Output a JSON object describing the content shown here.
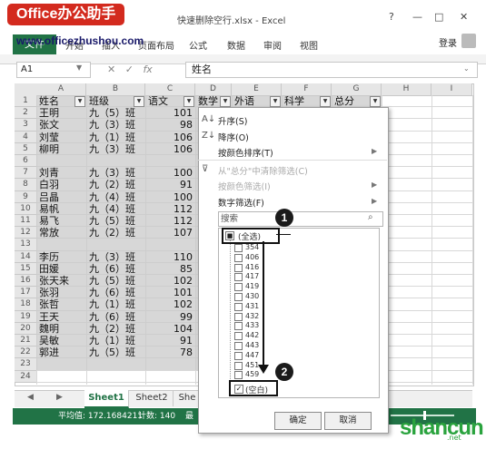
{
  "watermark_top": "Office办公助手",
  "site_url": "www.officezhushou.com",
  "window": {
    "title": "快速删除空行.xlsx - Excel",
    "help": "?",
    "minimize": "—",
    "restore": "□",
    "close": "✕"
  },
  "ribbon_tabs": [
    "文件",
    "开始",
    "插入",
    "页面布局",
    "公式",
    "数据",
    "审阅",
    "视图"
  ],
  "login": "登录",
  "namebox": "A1",
  "fx": "fx",
  "formula_value": "姓名",
  "col_headers": [
    "A",
    "B",
    "C",
    "D",
    "E",
    "F",
    "G",
    "H",
    "I"
  ],
  "table_headers": [
    "姓名",
    "班级",
    "语文",
    "数学",
    "外语",
    "科学",
    "总分"
  ],
  "rows": [
    [
      "2",
      "王明",
      "九（5）班",
      "101"
    ],
    [
      "3",
      "张文",
      "九（3）班",
      "98"
    ],
    [
      "4",
      "刘莹",
      "九（1）班",
      "106"
    ],
    [
      "5",
      "柳明",
      "九（3）班",
      "106"
    ],
    [
      "6",
      "",
      "",
      ""
    ],
    [
      "7",
      "刘青",
      "九（3）班",
      "100"
    ],
    [
      "8",
      "白羽",
      "九（2）班",
      "91"
    ],
    [
      "9",
      "吕晶",
      "九（4）班",
      "100"
    ],
    [
      "10",
      "易帆",
      "九（4）班",
      "112"
    ],
    [
      "11",
      "易飞",
      "九（5）班",
      "112"
    ],
    [
      "12",
      "常放",
      "九（2）班",
      "107"
    ],
    [
      "13",
      "",
      "",
      ""
    ],
    [
      "14",
      "李历",
      "九（3）班",
      "110"
    ],
    [
      "15",
      "田媛",
      "九（6）班",
      "85"
    ],
    [
      "16",
      "张天来",
      "九（5）班",
      "102"
    ],
    [
      "17",
      "张羽",
      "九（6）班",
      "101"
    ],
    [
      "18",
      "张哲",
      "九（1）班",
      "102"
    ],
    [
      "19",
      "王天",
      "九（6）班",
      "99"
    ],
    [
      "20",
      "魏明",
      "九（2）班",
      "104"
    ],
    [
      "21",
      "吴敏",
      "九（1）班",
      "91"
    ],
    [
      "22",
      "郭进",
      "九（5）班",
      "78"
    ],
    [
      "23",
      "",
      "",
      ""
    ],
    [
      "24",
      "",
      "",
      ""
    ]
  ],
  "sheet_tabs": [
    "Sheet1",
    "Sheet2",
    "She"
  ],
  "status": {
    "average": "平均值: 172.1684211",
    "count": "计数: 140",
    "max": "最"
  },
  "filter_menu": {
    "sort_asc": "升序(S)",
    "sort_desc": "降序(O)",
    "sort_color": "按颜色排序(T)",
    "clear_filter": "从\"总分\"中清除筛选(C)",
    "color_filter": "按颜色筛选(I)",
    "number_filter": "数字筛选(F)",
    "search_placeholder": "搜索",
    "select_all": "(全选)",
    "items": [
      "354",
      "406",
      "416",
      "417",
      "419",
      "430",
      "431",
      "432",
      "433",
      "442",
      "443",
      "447",
      "451",
      "459"
    ],
    "blank": "(空白)",
    "ok": "确定",
    "cancel": "取消"
  },
  "callouts": [
    "1",
    "2"
  ],
  "watermark_bottom": "shancun",
  "watermark_bottom_sub": ".net"
}
